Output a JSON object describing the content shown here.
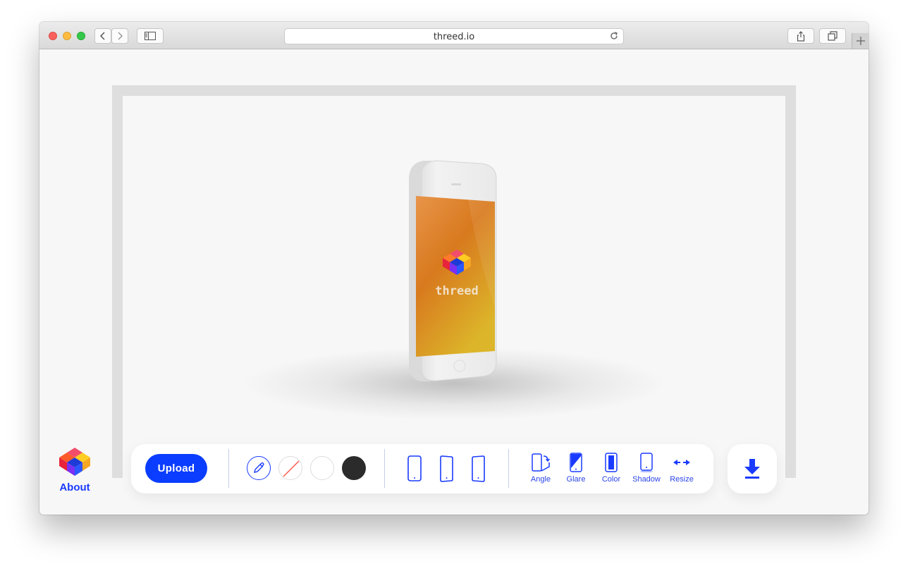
{
  "browser": {
    "url": "threed.io",
    "buttons": {
      "back": "chevron-left-icon",
      "forward": "chevron-right-icon",
      "sidebar": "sidebar-icon",
      "share": "share-icon",
      "tabs": "tabs-icon",
      "new_tab": "plus-icon",
      "reload": "reload-icon"
    }
  },
  "preview": {
    "screen_logo_text": "threed",
    "screen_gradient": [
      "#e8944a",
      "#d87a1e",
      "#dcb52a"
    ]
  },
  "about": {
    "label": "About"
  },
  "toolbar": {
    "upload_label": "Upload",
    "background_options": [
      "eyedropper",
      "transparent",
      "white",
      "black"
    ],
    "device_views": [
      "front",
      "angled-left",
      "angled-right"
    ],
    "options": [
      {
        "label": "Angle",
        "icon": "angle-icon"
      },
      {
        "label": "Glare",
        "icon": "glare-icon"
      },
      {
        "label": "Color",
        "icon": "color-icon"
      },
      {
        "label": "Shadow",
        "icon": "shadow-icon"
      },
      {
        "label": "Resize",
        "icon": "resize-icon"
      }
    ],
    "download_icon": "download-icon"
  },
  "colors": {
    "accent": "#0a3dff",
    "black_swatch": "#2b2b2b"
  }
}
